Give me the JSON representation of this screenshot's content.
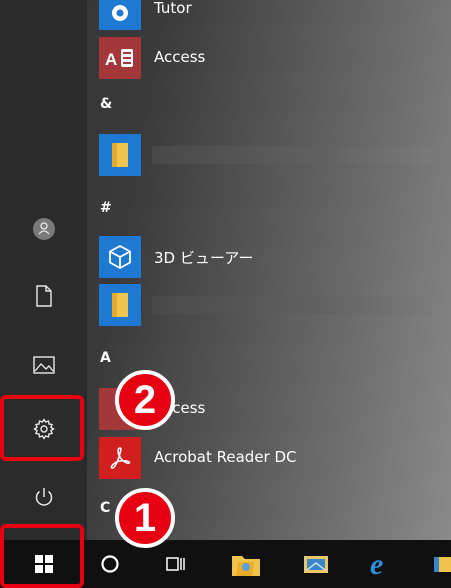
{
  "start_menu": {
    "apps": [
      {
        "id": "tutor",
        "label": "Tutor",
        "icon": "tutor-icon"
      },
      {
        "id": "access",
        "label": "Access",
        "icon": "access-icon"
      },
      {
        "id": "group_amp",
        "letter": "&"
      },
      {
        "id": "folder1",
        "label": "",
        "icon": "folder-icon"
      },
      {
        "id": "group_hash",
        "letter": "#"
      },
      {
        "id": "viewer3d",
        "label": "3D ビューアー",
        "icon": "cube-icon"
      },
      {
        "id": "folder2",
        "label": "",
        "icon": "folder-icon"
      },
      {
        "id": "group_a",
        "letter": "A"
      },
      {
        "id": "access2",
        "label": "Access",
        "icon": "access-icon"
      },
      {
        "id": "acrobat",
        "label": "Acrobat Reader DC",
        "icon": "acrobat-icon"
      },
      {
        "id": "group_c",
        "letter": "C"
      }
    ],
    "left_rail": [
      "user-icon",
      "document-icon",
      "pictures-icon",
      "settings-icon",
      "power-icon"
    ]
  },
  "taskbar": {
    "items": [
      "windows-start-icon",
      "search-circle-icon",
      "task-view-icon",
      "folder-app-icon",
      "mail-app-icon",
      "edge-icon",
      "explorer-icon"
    ]
  },
  "annotations": {
    "marker1": "1",
    "marker2": "2"
  },
  "colors": {
    "highlight": "#e60012",
    "tile_blue": "#1f78d1",
    "access_red": "#a4373a"
  }
}
